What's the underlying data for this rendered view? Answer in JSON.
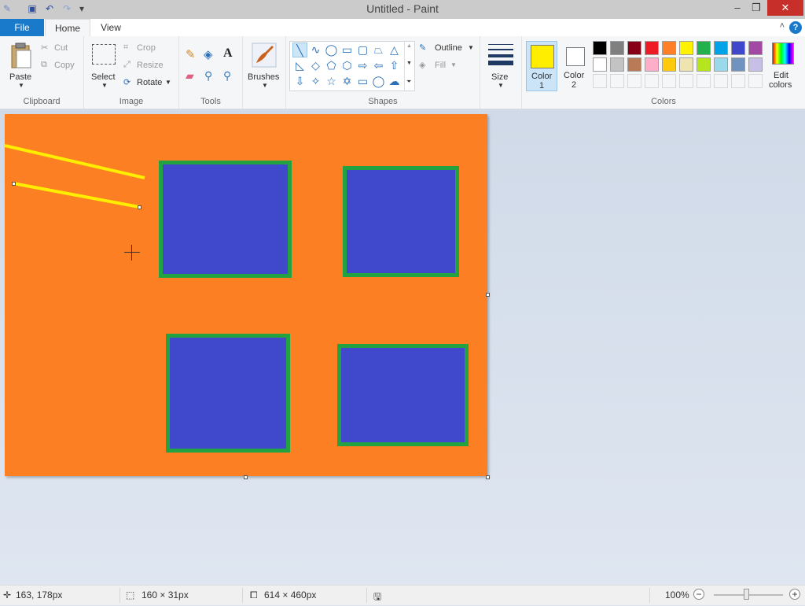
{
  "window": {
    "title": "Untitled - Paint"
  },
  "tabs": {
    "file": "File",
    "home": "Home",
    "view": "View"
  },
  "clipboard": {
    "paste": "Paste",
    "cut": "Cut",
    "copy": "Copy",
    "label": "Clipboard"
  },
  "image": {
    "select": "Select",
    "crop": "Crop",
    "resize": "Resize",
    "rotate": "Rotate",
    "label": "Image"
  },
  "tools": {
    "label": "Tools"
  },
  "brushes": {
    "label": "Brushes"
  },
  "shapes": {
    "outline": "Outline",
    "fill": "Fill",
    "label": "Shapes"
  },
  "size": {
    "label": "Size"
  },
  "colors": {
    "color1_line1": "Color",
    "color1_line2": "1",
    "color2_line1": "Color",
    "color2_line2": "2",
    "edit_line1": "Edit",
    "edit_line2": "colors",
    "label": "Colors",
    "color1": "#ffee00",
    "color2": "#ffffff",
    "palette_row1": [
      "#000000",
      "#7f7f7f",
      "#880015",
      "#ed1c24",
      "#ff7f27",
      "#fff200",
      "#22b14c",
      "#00a2e8",
      "#3f48cc",
      "#a349a4"
    ],
    "palette_row2": [
      "#ffffff",
      "#c3c3c3",
      "#b97a57",
      "#ffaec9",
      "#ffc90e",
      "#efe4b0",
      "#b5e61d",
      "#99d9ea",
      "#7092be",
      "#c8bfe7"
    ]
  },
  "canvas": {
    "background": "#fd7f23",
    "rect_fill": "#4048cc",
    "rect_outline": "#22a240",
    "line_color": "#ffee00"
  },
  "status": {
    "cursor_pos": "163, 178px",
    "selection_size": "160 × 31px",
    "image_size": "614 × 460px",
    "zoom": "100%"
  }
}
